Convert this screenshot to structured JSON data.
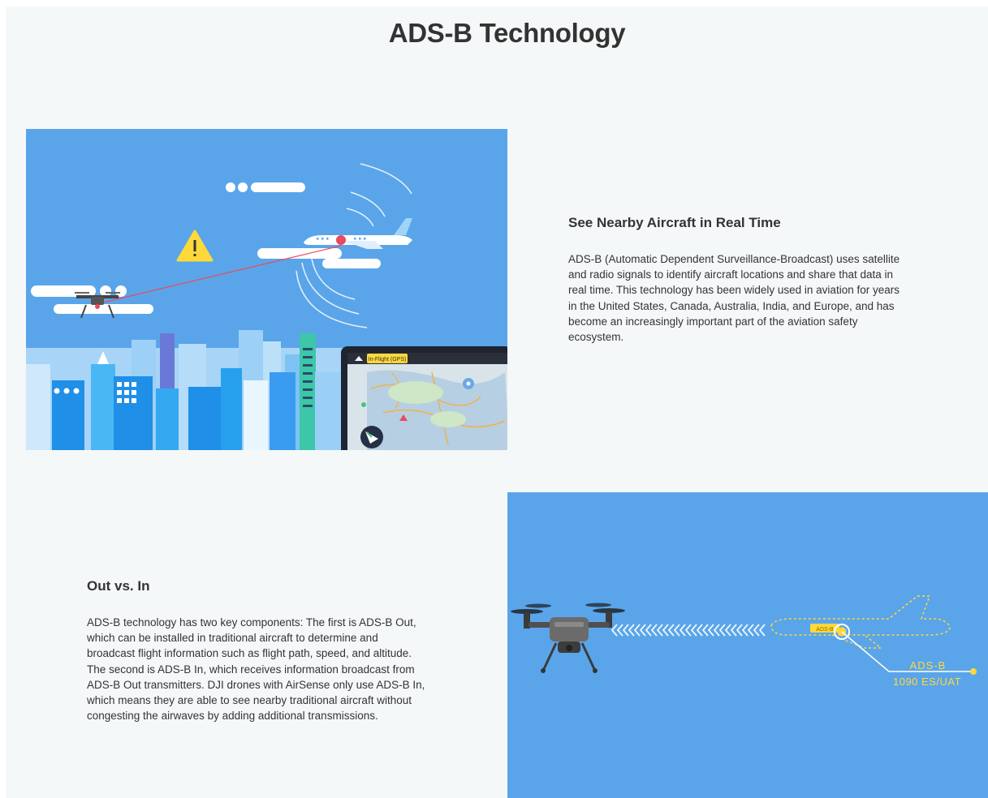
{
  "page": {
    "title": "ADS-B Technology"
  },
  "sections": [
    {
      "title": "See Nearby Aircraft in Real Time",
      "body": "ADS-B (Automatic Dependent Surveillance-Broadcast) uses satellite\nand radio signals to identify aircraft locations and share that data in\nreal time. This technology has been widely used in aviation for years\nin the United States, Canada, Australia, India, and Europe, and has\nbecome an increasingly important part of the aviation safety\necosystem."
    },
    {
      "title": "Out vs. In",
      "body": "ADS-B technology has two key components: The first is ADS-B Out,\nwhich can be installed in traditional aircraft to determine and\nbroadcast flight information such as flight path, speed, and altitude.\nThe second is ADS-B In, which receives information broadcast from\nADS-B Out transmitters. DJI drones with AirSense only use ADS-B In,\nwhich means they are able to see nearby traditional aircraft without\ncongesting the airwaves by adding additional transmissions."
    }
  ],
  "illustration1": {
    "app_status": "In-Flight (GPS)",
    "icons": [
      "warning-icon",
      "home-icon",
      "compass-icon",
      "aircraft-icon"
    ]
  },
  "illustration2": {
    "tag": "ADS-B",
    "label_line1": "ADS-B",
    "label_line2": "1090 ES/UAT"
  },
  "colors": {
    "illustration_bg": "#5aa5ea",
    "page_bg": "#f5f8f9",
    "text": "#333333",
    "accent_yellow": "#ffd83a",
    "signal_red": "#e84a5f"
  }
}
